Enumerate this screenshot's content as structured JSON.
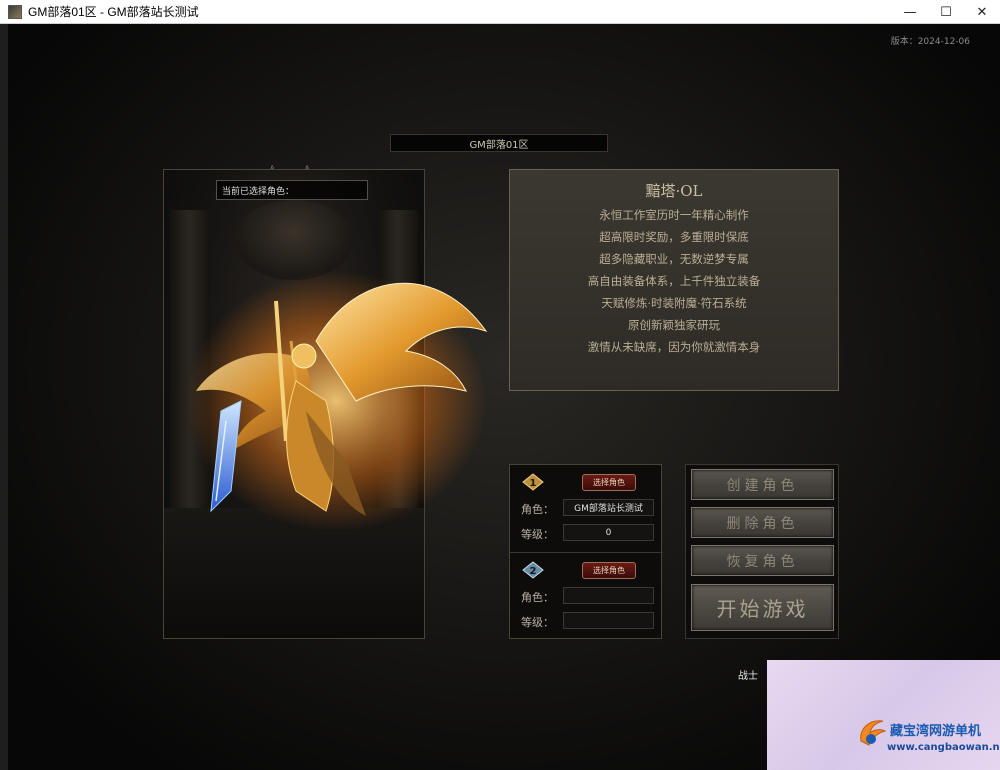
{
  "window": {
    "title": "GM部落01区 - GM部落站长测试",
    "controls": {
      "minimize": "—",
      "maximize": "☐",
      "close": "✕"
    }
  },
  "version": "版本：2024-12-06",
  "server_name": "GM部落01区",
  "preview": {
    "current_role_label": "当前已选择角色：",
    "pins": "ᐞ ᐞ"
  },
  "info": {
    "title": "黯塔·OL",
    "lines": [
      "永恒工作室历时一年精心制作",
      "超高限时奖励，多重限时保底",
      "超多隐藏职业，无数逆梦专属",
      "高自由装备体系，上千件独立装备",
      "天赋修炼·时装附魔·符石系统",
      "原创新颖独家研玩",
      "激情从未缺席，因为你就激情本身"
    ]
  },
  "slots": [
    {
      "number": "1",
      "select_label": "选择角色",
      "role_label": "角色：",
      "role_value": "GM部落站长测试",
      "level_label": "等级：",
      "level_value": "0"
    },
    {
      "number": "2",
      "select_label": "选择角色",
      "role_label": "角色：",
      "role_value": "",
      "level_label": "等级：",
      "level_value": ""
    }
  ],
  "actions": {
    "create": "创建角色",
    "delete": "删除角色",
    "restore": "恢复角色",
    "start": "开始游戏"
  },
  "class_label": "战士",
  "watermark": {
    "name": "藏宝湾网游单机",
    "url": "www.cangbaowan.net"
  },
  "colors": {
    "accent_gold": "#c9bfa3",
    "button_red": "#6a1a14"
  }
}
